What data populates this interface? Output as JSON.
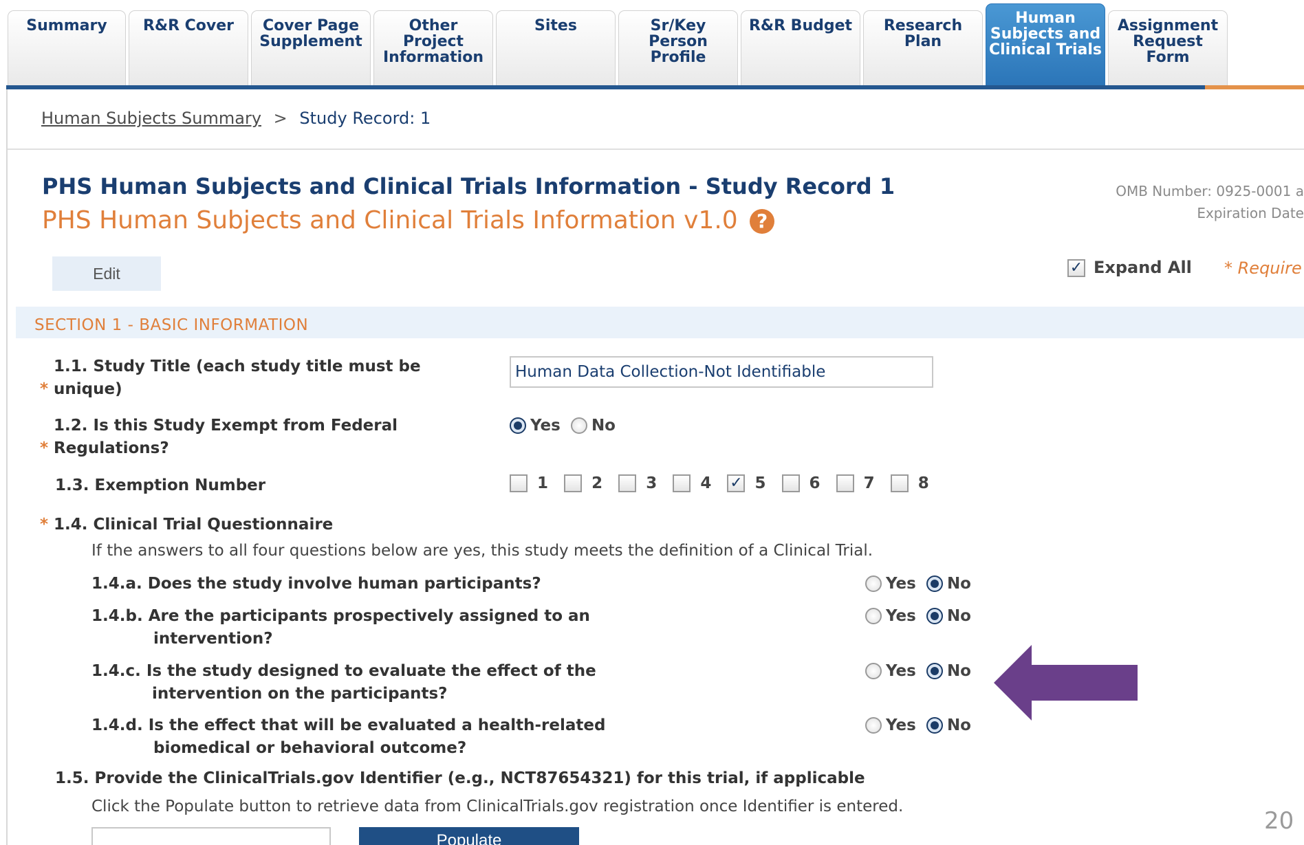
{
  "tabs": [
    {
      "label": "Summary",
      "active": false
    },
    {
      "label": "R&R Cover",
      "active": false
    },
    {
      "label": "Cover Page\nSupplement",
      "active": false
    },
    {
      "label": "Other\nProject\nInformation",
      "active": false
    },
    {
      "label": "Sites",
      "active": false
    },
    {
      "label": "Sr/Key\nPerson\nProfile",
      "active": false
    },
    {
      "label": "R&R Budget",
      "active": false
    },
    {
      "label": "Research\nPlan",
      "active": false
    },
    {
      "label": "Human\nSubjects and\nClinical Trials",
      "active": true
    },
    {
      "label": "Assignment\nRequest\nForm",
      "active": false
    }
  ],
  "breadcrumb": {
    "link": "Human Subjects Summary",
    "separator": ">",
    "current": "Study Record: 1"
  },
  "header": {
    "title": "PHS Human Subjects and Clinical Trials Information - Study Record 1",
    "subtitle": "PHS Human Subjects and Clinical Trials Information v1.0",
    "help_glyph": "?",
    "omb_line1": "OMB Number: 0925-0001 a",
    "omb_line2": "Expiration Date"
  },
  "toolbar": {
    "edit_label": "Edit",
    "expand_all_label": "Expand All",
    "expand_all_checked": true,
    "required_note": "* Require"
  },
  "section": {
    "title": "SECTION 1 - BASIC INFORMATION"
  },
  "questions": {
    "q1_1": {
      "star": "*",
      "label": "1.1. Study Title (each study title must be unique)",
      "value": "Human Data Collection-Not Identifiable"
    },
    "q1_2": {
      "star": "*",
      "label": "1.2. Is this Study Exempt from Federal Regulations?",
      "yes_label": "Yes",
      "no_label": "No",
      "selected": "Yes"
    },
    "q1_3": {
      "label": "1.3. Exemption Number",
      "options": [
        "1",
        "2",
        "3",
        "4",
        "5",
        "6",
        "7",
        "8"
      ],
      "checked": [
        "5"
      ]
    },
    "q1_4": {
      "star": "*",
      "label": "1.4. Clinical Trial Questionnaire",
      "note": "If the answers to all four questions below are yes, this study meets the definition of a Clinical Trial.",
      "a": {
        "label": "1.4.a. Does the study involve human participants?",
        "selected": "No"
      },
      "b": {
        "label": "1.4.b. Are the participants prospectively assigned to an intervention?",
        "selected": "No"
      },
      "c": {
        "label": "1.4.c. Is the study designed to evaluate the effect of the intervention on the participants?",
        "selected": "No"
      },
      "d": {
        "label": "1.4.d. Is the effect that will be evaluated a health-related biomedical or behavioral outcome?",
        "selected": "No"
      },
      "yes_label": "Yes",
      "no_label": "No"
    },
    "q1_5": {
      "label": "1.5. Provide the ClinicalTrials.gov Identifier (e.g., NCT87654321) for this trial, if applicable",
      "note": "Click the Populate button to retrieve data from ClinicalTrials.gov registration once Identifier is entered.",
      "value": "",
      "button_label": "Populate"
    }
  },
  "page_number": "20",
  "colors": {
    "navy": "#1a3e70",
    "orange": "#e07f3a",
    "active_tab": "#2b75b8",
    "arrow": "#6a3f8a"
  }
}
